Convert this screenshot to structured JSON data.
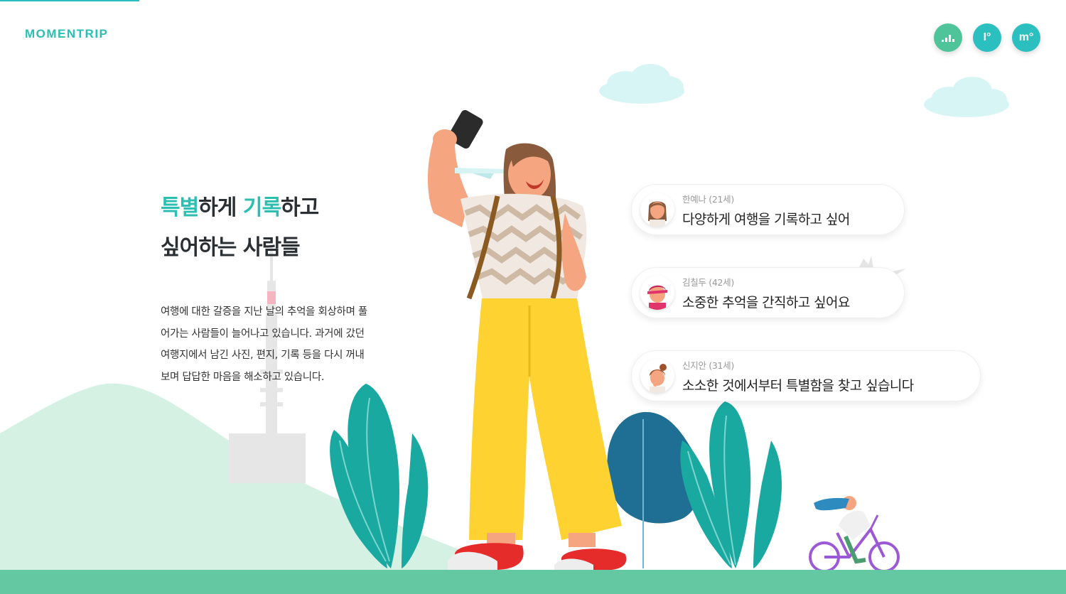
{
  "brand": {
    "logo": "MOMENTRIP"
  },
  "top_buttons": [
    {
      "label": "",
      "icon": "bar-chart-icon"
    },
    {
      "label": "I°",
      "icon": "i-degree-icon"
    },
    {
      "label": "m°",
      "icon": "m-degree-icon"
    }
  ],
  "hero": {
    "line1_accent1": "특별",
    "line1_mid": "하게 ",
    "line1_accent2": "기록",
    "line1_end": "하고",
    "line2": "싶어하는 사람들",
    "description": [
      "여행에 대한 갈증을 지난 날의 추억을 회상하며 풀",
      "어가는 사람들이 늘어나고 있습니다. 과거에 갔던",
      "여행지에서 남긴 사진, 편지, 기록 등을 다시 꺼내",
      "보며 답답한 마음을 해소하고 있습니다."
    ]
  },
  "testimonials": [
    {
      "name": "한예나 (21세)",
      "quote": "다양하게 여행을 기록하고 싶어"
    },
    {
      "name": "김칠두 (42세)",
      "quote": "소중한 추억을 간직하고 싶어요"
    },
    {
      "name": "신지안 (31세)",
      "quote": "소소한 것에서부터 특별함을 찾고 싶습니다"
    }
  ],
  "colors": {
    "accent": "#2bbfb2",
    "button_green": "#4fc39a",
    "button_teal": "#2bbfc0",
    "ground": "#64c8a3",
    "hill": "#d5f1e3",
    "pants": "#fdd231",
    "leaf": "#1aa9a1",
    "cloud": "#d8f5f6"
  }
}
